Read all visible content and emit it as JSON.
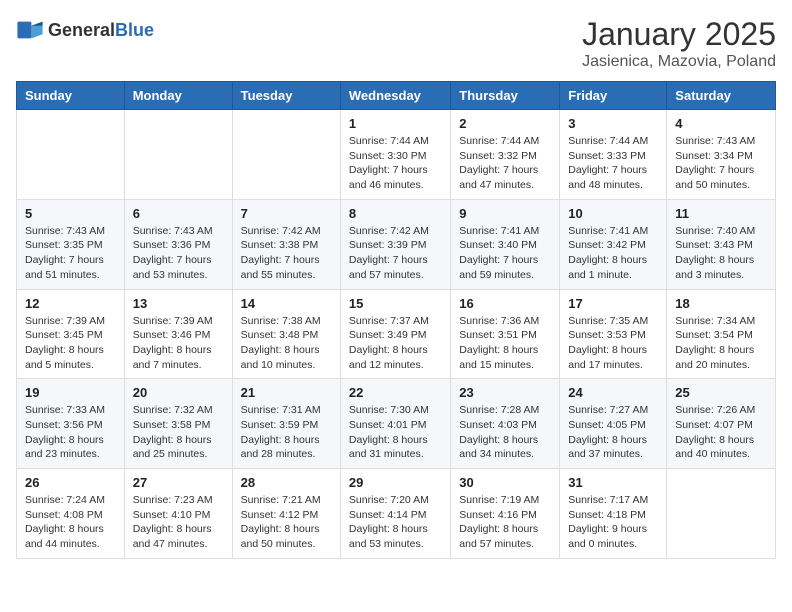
{
  "header": {
    "logo_general": "General",
    "logo_blue": "Blue",
    "month": "January 2025",
    "location": "Jasienica, Mazovia, Poland"
  },
  "weekdays": [
    "Sunday",
    "Monday",
    "Tuesday",
    "Wednesday",
    "Thursday",
    "Friday",
    "Saturday"
  ],
  "weeks": [
    [
      {
        "day": "",
        "info": ""
      },
      {
        "day": "",
        "info": ""
      },
      {
        "day": "",
        "info": ""
      },
      {
        "day": "1",
        "info": "Sunrise: 7:44 AM\nSunset: 3:30 PM\nDaylight: 7 hours and 46 minutes."
      },
      {
        "day": "2",
        "info": "Sunrise: 7:44 AM\nSunset: 3:32 PM\nDaylight: 7 hours and 47 minutes."
      },
      {
        "day": "3",
        "info": "Sunrise: 7:44 AM\nSunset: 3:33 PM\nDaylight: 7 hours and 48 minutes."
      },
      {
        "day": "4",
        "info": "Sunrise: 7:43 AM\nSunset: 3:34 PM\nDaylight: 7 hours and 50 minutes."
      }
    ],
    [
      {
        "day": "5",
        "info": "Sunrise: 7:43 AM\nSunset: 3:35 PM\nDaylight: 7 hours and 51 minutes."
      },
      {
        "day": "6",
        "info": "Sunrise: 7:43 AM\nSunset: 3:36 PM\nDaylight: 7 hours and 53 minutes."
      },
      {
        "day": "7",
        "info": "Sunrise: 7:42 AM\nSunset: 3:38 PM\nDaylight: 7 hours and 55 minutes."
      },
      {
        "day": "8",
        "info": "Sunrise: 7:42 AM\nSunset: 3:39 PM\nDaylight: 7 hours and 57 minutes."
      },
      {
        "day": "9",
        "info": "Sunrise: 7:41 AM\nSunset: 3:40 PM\nDaylight: 7 hours and 59 minutes."
      },
      {
        "day": "10",
        "info": "Sunrise: 7:41 AM\nSunset: 3:42 PM\nDaylight: 8 hours and 1 minute."
      },
      {
        "day": "11",
        "info": "Sunrise: 7:40 AM\nSunset: 3:43 PM\nDaylight: 8 hours and 3 minutes."
      }
    ],
    [
      {
        "day": "12",
        "info": "Sunrise: 7:39 AM\nSunset: 3:45 PM\nDaylight: 8 hours and 5 minutes."
      },
      {
        "day": "13",
        "info": "Sunrise: 7:39 AM\nSunset: 3:46 PM\nDaylight: 8 hours and 7 minutes."
      },
      {
        "day": "14",
        "info": "Sunrise: 7:38 AM\nSunset: 3:48 PM\nDaylight: 8 hours and 10 minutes."
      },
      {
        "day": "15",
        "info": "Sunrise: 7:37 AM\nSunset: 3:49 PM\nDaylight: 8 hours and 12 minutes."
      },
      {
        "day": "16",
        "info": "Sunrise: 7:36 AM\nSunset: 3:51 PM\nDaylight: 8 hours and 15 minutes."
      },
      {
        "day": "17",
        "info": "Sunrise: 7:35 AM\nSunset: 3:53 PM\nDaylight: 8 hours and 17 minutes."
      },
      {
        "day": "18",
        "info": "Sunrise: 7:34 AM\nSunset: 3:54 PM\nDaylight: 8 hours and 20 minutes."
      }
    ],
    [
      {
        "day": "19",
        "info": "Sunrise: 7:33 AM\nSunset: 3:56 PM\nDaylight: 8 hours and 23 minutes."
      },
      {
        "day": "20",
        "info": "Sunrise: 7:32 AM\nSunset: 3:58 PM\nDaylight: 8 hours and 25 minutes."
      },
      {
        "day": "21",
        "info": "Sunrise: 7:31 AM\nSunset: 3:59 PM\nDaylight: 8 hours and 28 minutes."
      },
      {
        "day": "22",
        "info": "Sunrise: 7:30 AM\nSunset: 4:01 PM\nDaylight: 8 hours and 31 minutes."
      },
      {
        "day": "23",
        "info": "Sunrise: 7:28 AM\nSunset: 4:03 PM\nDaylight: 8 hours and 34 minutes."
      },
      {
        "day": "24",
        "info": "Sunrise: 7:27 AM\nSunset: 4:05 PM\nDaylight: 8 hours and 37 minutes."
      },
      {
        "day": "25",
        "info": "Sunrise: 7:26 AM\nSunset: 4:07 PM\nDaylight: 8 hours and 40 minutes."
      }
    ],
    [
      {
        "day": "26",
        "info": "Sunrise: 7:24 AM\nSunset: 4:08 PM\nDaylight: 8 hours and 44 minutes."
      },
      {
        "day": "27",
        "info": "Sunrise: 7:23 AM\nSunset: 4:10 PM\nDaylight: 8 hours and 47 minutes."
      },
      {
        "day": "28",
        "info": "Sunrise: 7:21 AM\nSunset: 4:12 PM\nDaylight: 8 hours and 50 minutes."
      },
      {
        "day": "29",
        "info": "Sunrise: 7:20 AM\nSunset: 4:14 PM\nDaylight: 8 hours and 53 minutes."
      },
      {
        "day": "30",
        "info": "Sunrise: 7:19 AM\nSunset: 4:16 PM\nDaylight: 8 hours and 57 minutes."
      },
      {
        "day": "31",
        "info": "Sunrise: 7:17 AM\nSunset: 4:18 PM\nDaylight: 9 hours and 0 minutes."
      },
      {
        "day": "",
        "info": ""
      }
    ]
  ]
}
